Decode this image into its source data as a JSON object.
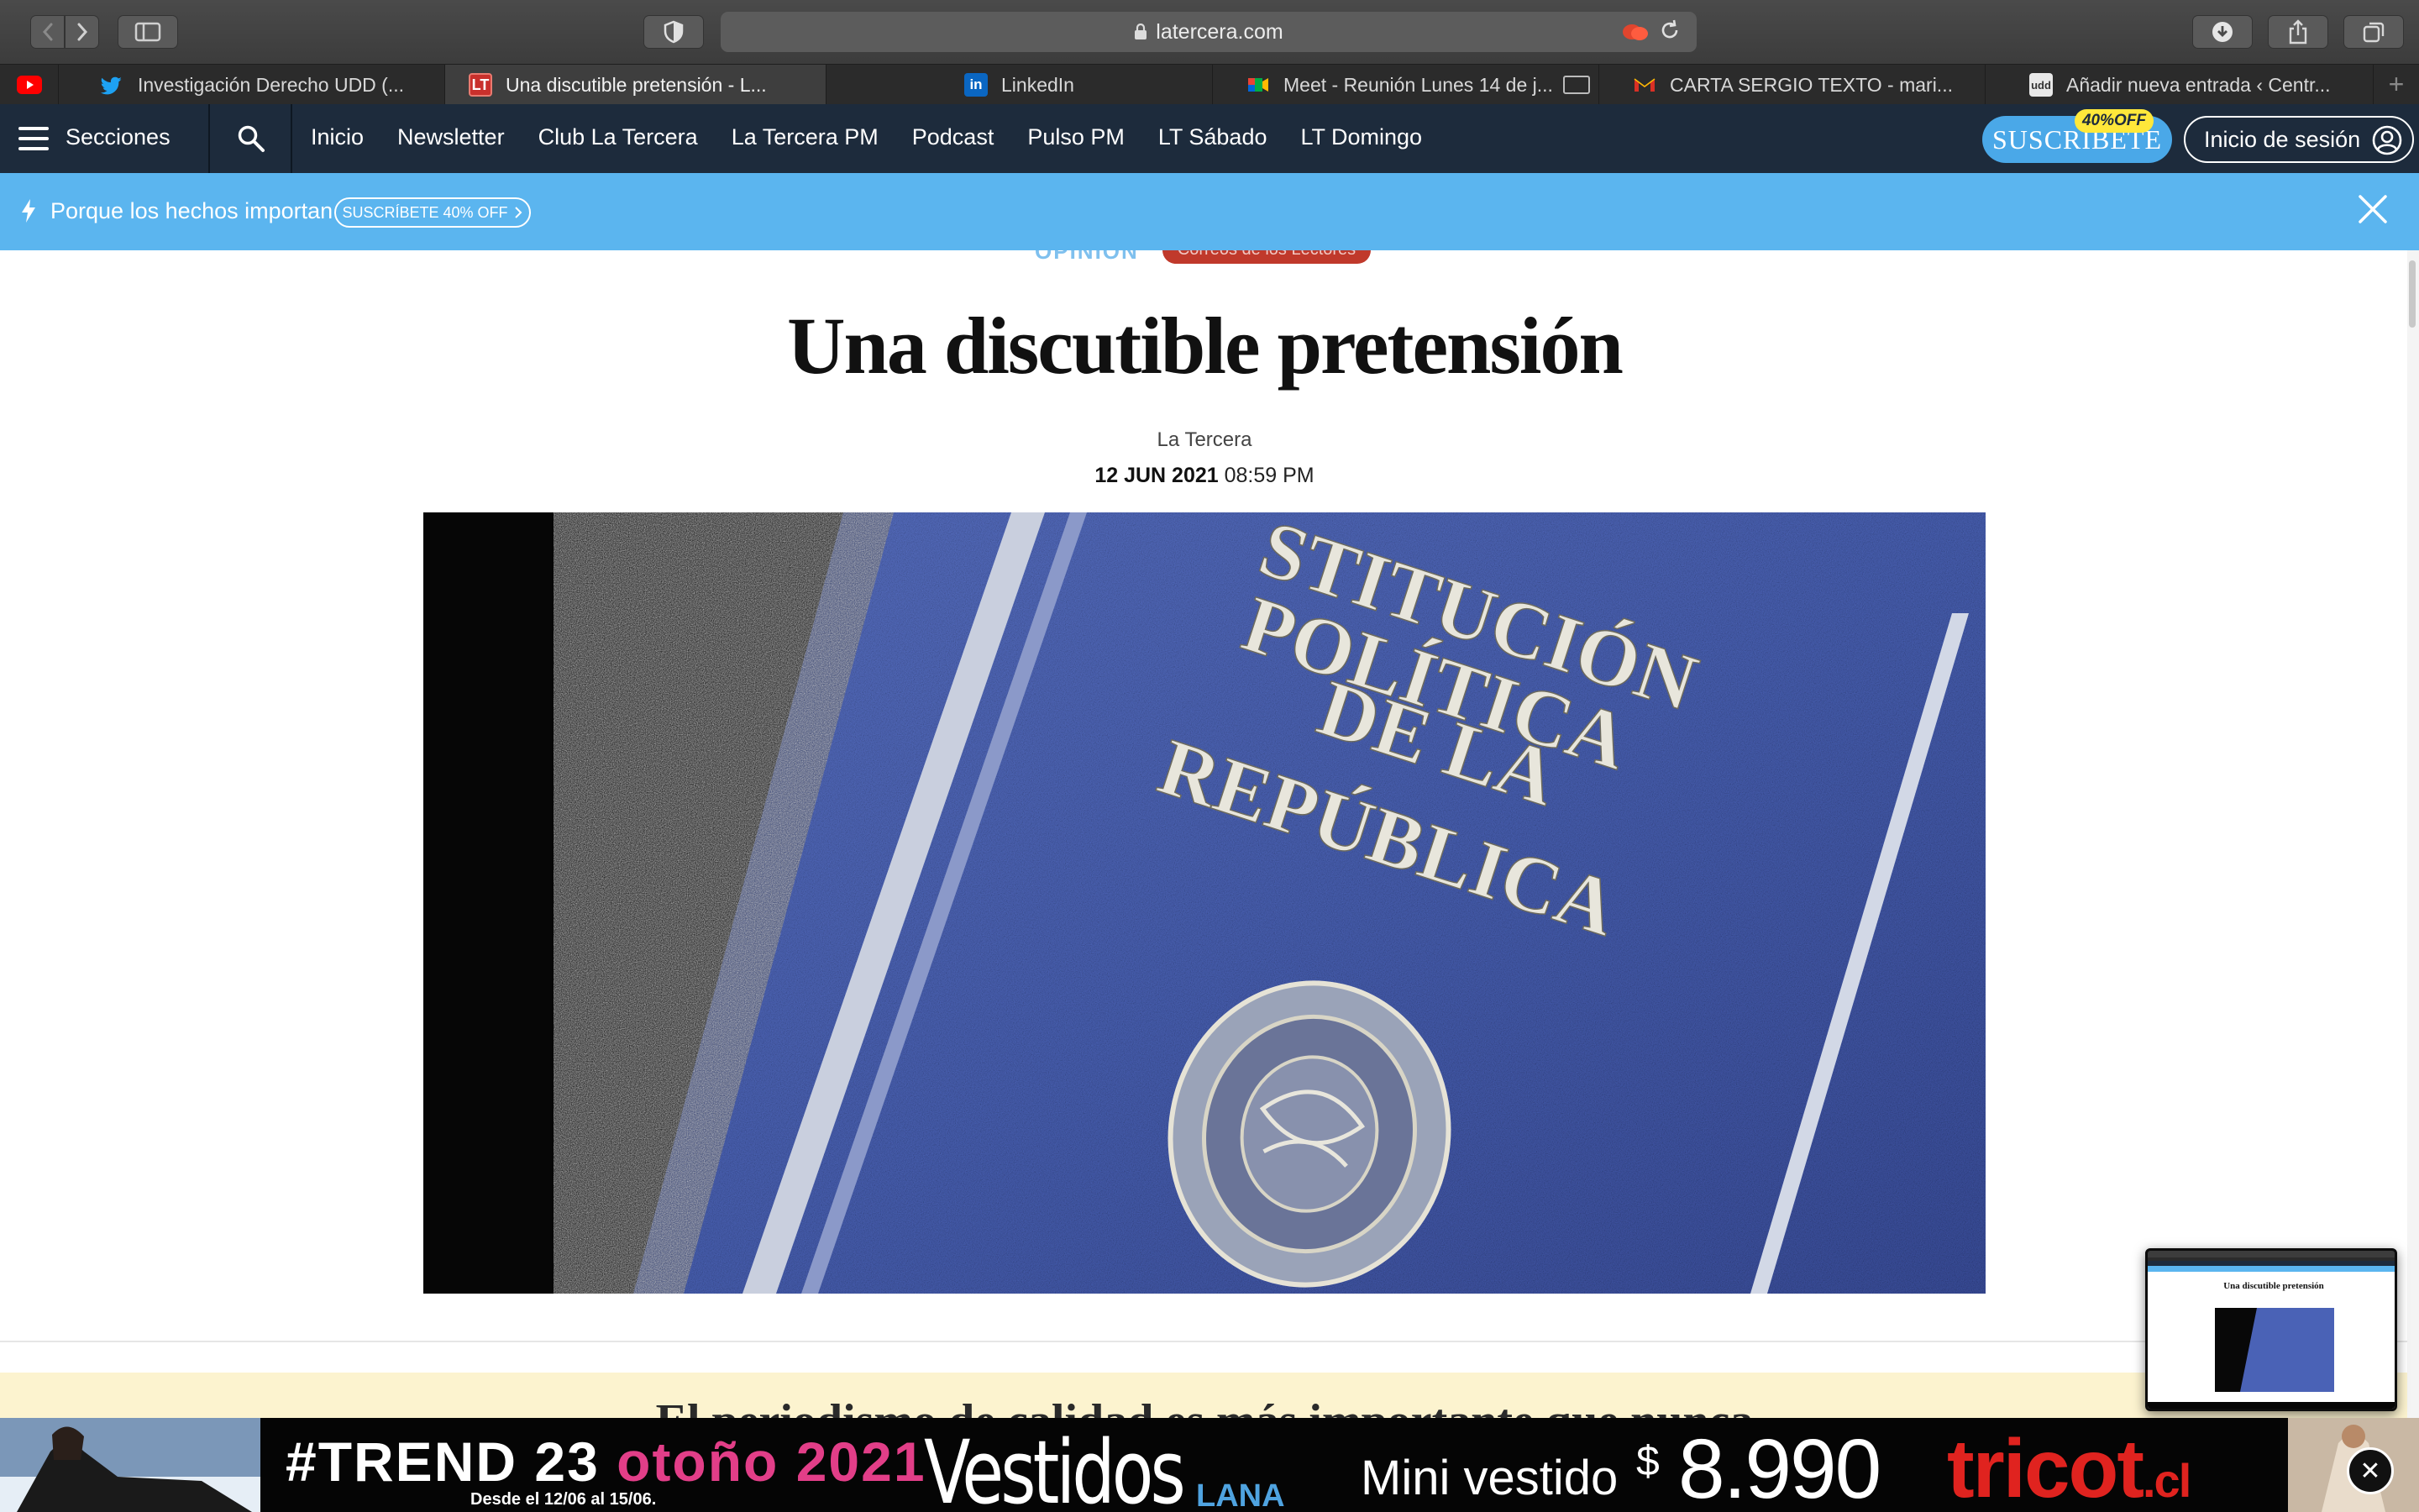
{
  "browser": {
    "url": "latercera.com",
    "tabs": [
      {
        "title": "Investigación Derecho UDD (...",
        "icon": "twitter-icon",
        "color": "#1da1f2"
      },
      {
        "title": "Una discutible pretensión - L...",
        "icon": "la-tercera-icon",
        "color": "#d9372b",
        "active": true
      },
      {
        "title": "LinkedIn",
        "icon": "linkedin-icon",
        "color": "#0a66c2"
      },
      {
        "title": "Meet - Reunión Lunes 14 de j...",
        "icon": "meet-icon",
        "color": "#00897b"
      },
      {
        "title": "CARTA SERGIO TEXTO - mari...",
        "icon": "gmail-icon",
        "color": "#d93025"
      },
      {
        "title": "Añadir nueva entrada ‹ Centr...",
        "icon": "udd-icon",
        "color": "#ffffff"
      }
    ],
    "pinned_icon": "youtube-icon"
  },
  "sitenav": {
    "menu_label": "Secciones",
    "links": [
      "Inicio",
      "Newsletter",
      "Club La Tercera",
      "La Tercera PM",
      "Podcast",
      "Pulso PM",
      "LT Sábado",
      "LT Domingo"
    ],
    "subscribe_label": "SUSCRÍBETE",
    "subscribe_badge": "40%OFF",
    "login_label": "Inicio de sesión",
    "bg_color": "#1d2b3c",
    "accent_color": "#4aa8e8"
  },
  "promo": {
    "text": "Porque los hechos importan",
    "button": "SUSCRÍBETE 40% OFF",
    "bg_color": "#5bb5ef"
  },
  "article": {
    "section": "OPINIÓN",
    "tag": "Correos de los Lectores",
    "title": "Una discutible pretensión",
    "author": "La Tercera",
    "date": "12 JUN 2021",
    "time": "08:59 PM",
    "image_text": [
      "STITUCIÓN",
      "POLÍTICA",
      "DE LA",
      "REPÚBLICA"
    ],
    "paywall_heading": "El periodismo de calidad es más importante que nunca"
  },
  "ad": {
    "trend_prefix": "#TREND 23",
    "trend_season": "otoño 2021",
    "dates": "Desde el 12/06 al 15/06.",
    "vestidos": "Vestidos",
    "lana": "LANA",
    "mini": "Mini vestido",
    "currency": "$",
    "price": "8.990",
    "brand": "tricot",
    "brand_suffix": ".cl"
  },
  "thumbnail": {
    "title": "Una discutible pretensión"
  }
}
